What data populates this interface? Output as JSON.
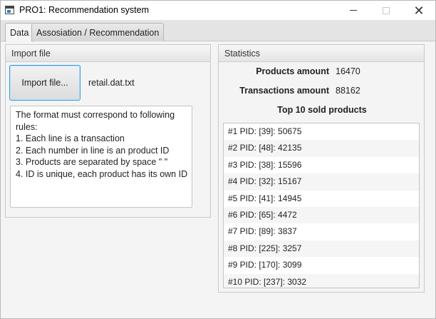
{
  "window": {
    "title": "PRO1: Recommendation system"
  },
  "tabs": [
    {
      "label": "Data"
    },
    {
      "label": "Assosiation / Recommendation"
    }
  ],
  "import_panel": {
    "header": "Import file",
    "button_label": "Import file...",
    "file_name": "retail.dat.txt",
    "rules": [
      "The format must correspond to following",
      "rules:",
      "1. Each line is a transaction",
      "2. Each number in line is an product ID",
      "3. Products are separated by space \" \"",
      "4. ID is unique, each product has its own ID"
    ]
  },
  "stats_panel": {
    "header": "Statistics",
    "products_label": "Products amount",
    "products_value": "16470",
    "transactions_label": "Transactions amount",
    "transactions_value": "88162",
    "top_title": "Top 10 sold products",
    "top_products": [
      "#1 PID: [39]: 50675",
      "#2 PID: [48]: 42135",
      "#3 PID: [38]: 15596",
      "#4 PID: [32]: 15167",
      "#5 PID: [41]: 14945",
      "#6 PID: [65]: 4472",
      "#7 PID: [89]: 3837",
      "#8 PID: [225]: 3257",
      "#9 PID: [170]: 3099",
      "#10 PID: [237]: 3032"
    ]
  },
  "colors": {
    "focus_border": "#2e9de4",
    "panel_bg": "#f4f4f4"
  }
}
